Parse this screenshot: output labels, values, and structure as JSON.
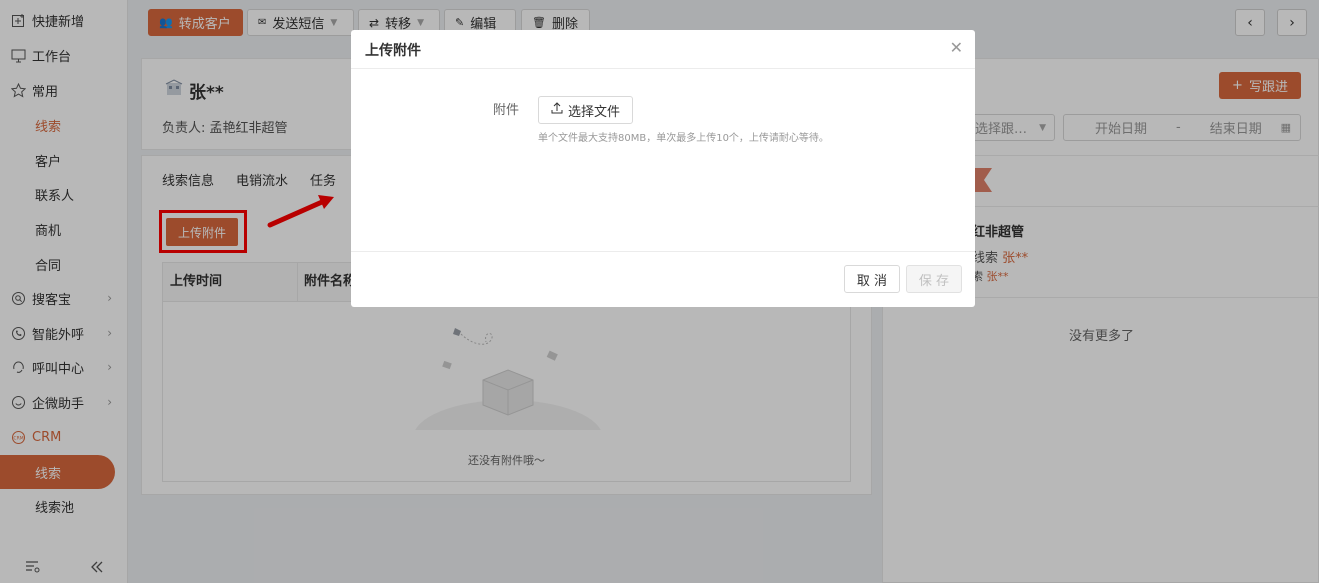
{
  "sidebar": {
    "items": [
      {
        "label": "快捷新增",
        "icon": "quick-add-icon"
      },
      {
        "label": "工作台",
        "icon": "monitor-icon"
      },
      {
        "label": "常用",
        "icon": "star-icon"
      },
      {
        "label": "线索"
      },
      {
        "label": "客户"
      },
      {
        "label": "联系人"
      },
      {
        "label": "商机"
      },
      {
        "label": "合同"
      },
      {
        "label": "搜客宝",
        "icon": "search-circle-icon"
      },
      {
        "label": "智能外呼",
        "icon": "phone-circle-icon"
      },
      {
        "label": "呼叫中心",
        "icon": "headset-icon"
      },
      {
        "label": "企微助手",
        "icon": "smile-icon"
      },
      {
        "label": "CRM",
        "icon": "crm-icon"
      },
      {
        "label": "线索"
      },
      {
        "label": "线索池"
      }
    ]
  },
  "toolbar": {
    "convert": "转成客户",
    "sms": "发送短信",
    "transfer": "转移",
    "edit": "编辑",
    "delete": "删除"
  },
  "lead": {
    "name": "张**",
    "owner_label": "负责人:",
    "owner": "孟艳红非超管"
  },
  "tabs": [
    "线索信息",
    "电销流水",
    "任务"
  ],
  "attachments": {
    "upload_label": "上传附件",
    "col_time": "上传时间",
    "col_name": "附件名称",
    "empty": "还没有附件哦～"
  },
  "right": {
    "write_label": "写跟进",
    "filter_placeholder": "选择跟…",
    "start_date": "开始日期",
    "date_sep": "-",
    "end_date": "结束日期",
    "feed_user": "红非超管",
    "feed_line1_prefix": "线索",
    "feed_line1_name": "张**",
    "feed_line2_prefix": "索",
    "feed_line2_name": "张**",
    "no_more": "没有更多了"
  },
  "modal": {
    "title": "上传附件",
    "field_label": "附件",
    "choose": "选择文件",
    "hint": "单个文件最大支持80MB，单次最多上传10个，上传请耐心等待。",
    "cancel": "取 消",
    "save": "保 存"
  },
  "colors": {
    "accent": "#d9693e",
    "highlight": "#ff0000"
  }
}
